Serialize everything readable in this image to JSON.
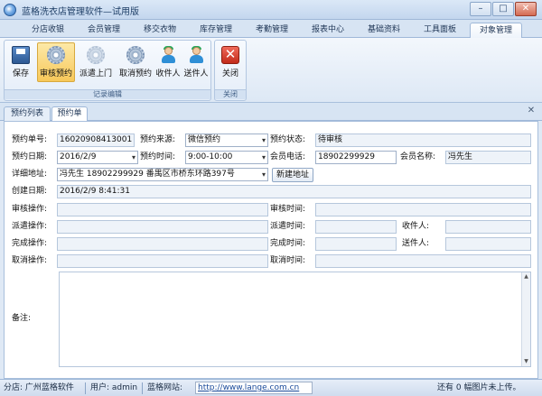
{
  "window": {
    "title": "蓝格洗衣店管理软件—试用版",
    "minimize": "–",
    "maximize": "□",
    "close": "✕"
  },
  "menu_tabs": [
    {
      "label": "分店收银"
    },
    {
      "label": "会员管理"
    },
    {
      "label": "移交衣物"
    },
    {
      "label": "库存管理"
    },
    {
      "label": "考勤管理"
    },
    {
      "label": "报表中心"
    },
    {
      "label": "基础资料"
    },
    {
      "label": "工具面板"
    },
    {
      "label": "对象管理",
      "active": true
    }
  ],
  "ribbon": {
    "group1": {
      "label": "记录编辑",
      "buttons": [
        {
          "label": "保存",
          "icon": "save-icon"
        },
        {
          "label": "审核预约",
          "icon": "gear-icon",
          "active": true
        },
        {
          "label": "派遣上门",
          "icon": "gear-icon",
          "disabled": true
        },
        {
          "label": "取消预约",
          "icon": "gear-icon"
        },
        {
          "label": "收件人",
          "icon": "person-icon"
        },
        {
          "label": "送件人",
          "icon": "person-icon"
        }
      ]
    },
    "group2": {
      "label": "关闭",
      "buttons": [
        {
          "label": "关闭",
          "icon": "close-icon"
        }
      ]
    }
  },
  "sub_tabs": [
    {
      "label": "预约列表"
    },
    {
      "label": "预约单",
      "active": true
    }
  ],
  "form": {
    "order_no_label": "预约单号:",
    "order_no": "16020908413001",
    "source_label": "预约来源:",
    "source": "微信预约",
    "status_label": "预约状态:",
    "status": "待审核",
    "date_label": "预约日期:",
    "date": "2016/2/9",
    "time_label": "预约时间:",
    "time": "9:00-10:00",
    "phone_label": "会员电话:",
    "phone": "18902299929",
    "name_label": "会员名称:",
    "name": "冯先生",
    "address_label": "详细地址:",
    "address": "冯先生  18902299929  番禺区市桥东环路397号",
    "new_address_button": "新建地址",
    "created_label": "创建日期:",
    "created": "2016/2/9 8:41:31",
    "audit_op_label": "审核操作:",
    "audit_time_label": "审核时间:",
    "dispatch_op_label": "派遣操作:",
    "dispatch_time_label": "派遣时间:",
    "receiver_label": "收件人:",
    "complete_op_label": "完成操作:",
    "complete_time_label": "完成时间:",
    "sender_label": "送件人:",
    "cancel_op_label": "取消操作:",
    "cancel_time_label": "取消时间:",
    "remark_label": "备注:"
  },
  "statusbar": {
    "branch": "分店: 广州蓝格软件",
    "user": "用户: admin",
    "site_label": "蓝格网站:",
    "url": "http://www.lange.com.cn",
    "upload": "还有 0 幅图片未上传。"
  }
}
